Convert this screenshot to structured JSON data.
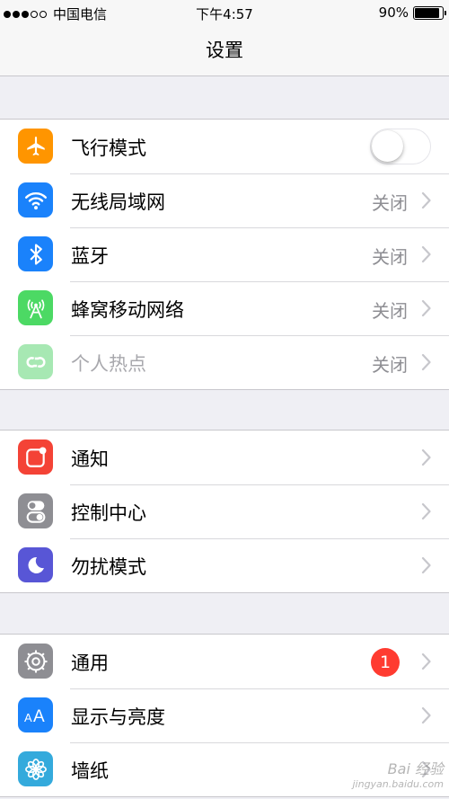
{
  "status_bar": {
    "carrier": "中国电信",
    "signal_dots": 5,
    "signal_filled": 3,
    "time": "下午4:57",
    "battery_text": "90%",
    "battery_level": 0.9
  },
  "nav": {
    "title": "设置"
  },
  "groups": [
    [
      {
        "id": "airplane",
        "label": "飞行模式",
        "icon": "airplane-icon",
        "color": "#ff9500",
        "accessory": "toggle",
        "toggle_on": false
      },
      {
        "id": "wifi",
        "label": "无线局域网",
        "icon": "wifi-icon",
        "color": "#1a82fb",
        "value": "关闭",
        "accessory": "chevron"
      },
      {
        "id": "bluetooth",
        "label": "蓝牙",
        "icon": "bluetooth-icon",
        "color": "#1a82fb",
        "value": "关闭",
        "accessory": "chevron"
      },
      {
        "id": "cellular",
        "label": "蜂窝移动网络",
        "icon": "antenna-icon",
        "color": "#4cd964",
        "value": "关闭",
        "accessory": "chevron"
      },
      {
        "id": "hotspot",
        "label": "个人热点",
        "icon": "hotspot-icon",
        "color": "#a7e8b3",
        "value": "关闭",
        "accessory": "chevron",
        "disabled": true
      }
    ],
    [
      {
        "id": "notifications",
        "label": "通知",
        "icon": "notifications-icon",
        "color": "#f44336",
        "accessory": "chevron"
      },
      {
        "id": "control-center",
        "label": "控制中心",
        "icon": "switches-icon",
        "color": "#8e8e93",
        "accessory": "chevron"
      },
      {
        "id": "do-not-disturb",
        "label": "勿扰模式",
        "icon": "moon-icon",
        "color": "#5856d6",
        "accessory": "chevron"
      }
    ],
    [
      {
        "id": "general",
        "label": "通用",
        "icon": "gear-icon",
        "color": "#8e8e93",
        "badge": "1",
        "accessory": "chevron"
      },
      {
        "id": "display",
        "label": "显示与亮度",
        "icon": "text-size-icon",
        "color": "#1a82fb",
        "accessory": "chevron"
      },
      {
        "id": "wallpaper",
        "label": "墙纸",
        "icon": "flower-icon",
        "color": "#34aadc",
        "accessory": "chevron"
      }
    ]
  ],
  "watermark": {
    "text": "Bai 经验",
    "sub": "jingyan.baidu.com"
  }
}
